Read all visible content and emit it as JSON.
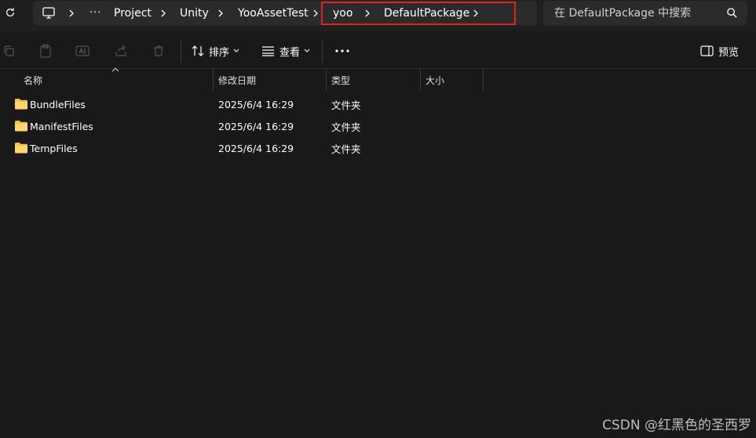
{
  "address_bar": {
    "breadcrumbs": [
      "Project",
      "Unity",
      "YooAssetTest",
      "yoo",
      "DefaultPackage"
    ],
    "more_label": "···"
  },
  "search": {
    "placeholder": "在 DefaultPackage 中搜索"
  },
  "command_bar": {
    "sort_label": "排序",
    "view_label": "查看",
    "more_label": "···",
    "preview_label": "预览"
  },
  "columns": {
    "name": "名称",
    "modified": "修改日期",
    "type": "类型",
    "size": "大小"
  },
  "files": [
    {
      "name": "BundleFiles",
      "modified": "2025/6/4 16:29",
      "type": "文件夹",
      "size": ""
    },
    {
      "name": "ManifestFiles",
      "modified": "2025/6/4 16:29",
      "type": "文件夹",
      "size": ""
    },
    {
      "name": "TempFiles",
      "modified": "2025/6/4 16:29",
      "type": "文件夹",
      "size": ""
    }
  ],
  "watermark": "CSDN @红黑色的圣西罗",
  "colors": {
    "background": "#191919",
    "highlight_box": "#e02424",
    "folder": "#f4c54a"
  }
}
